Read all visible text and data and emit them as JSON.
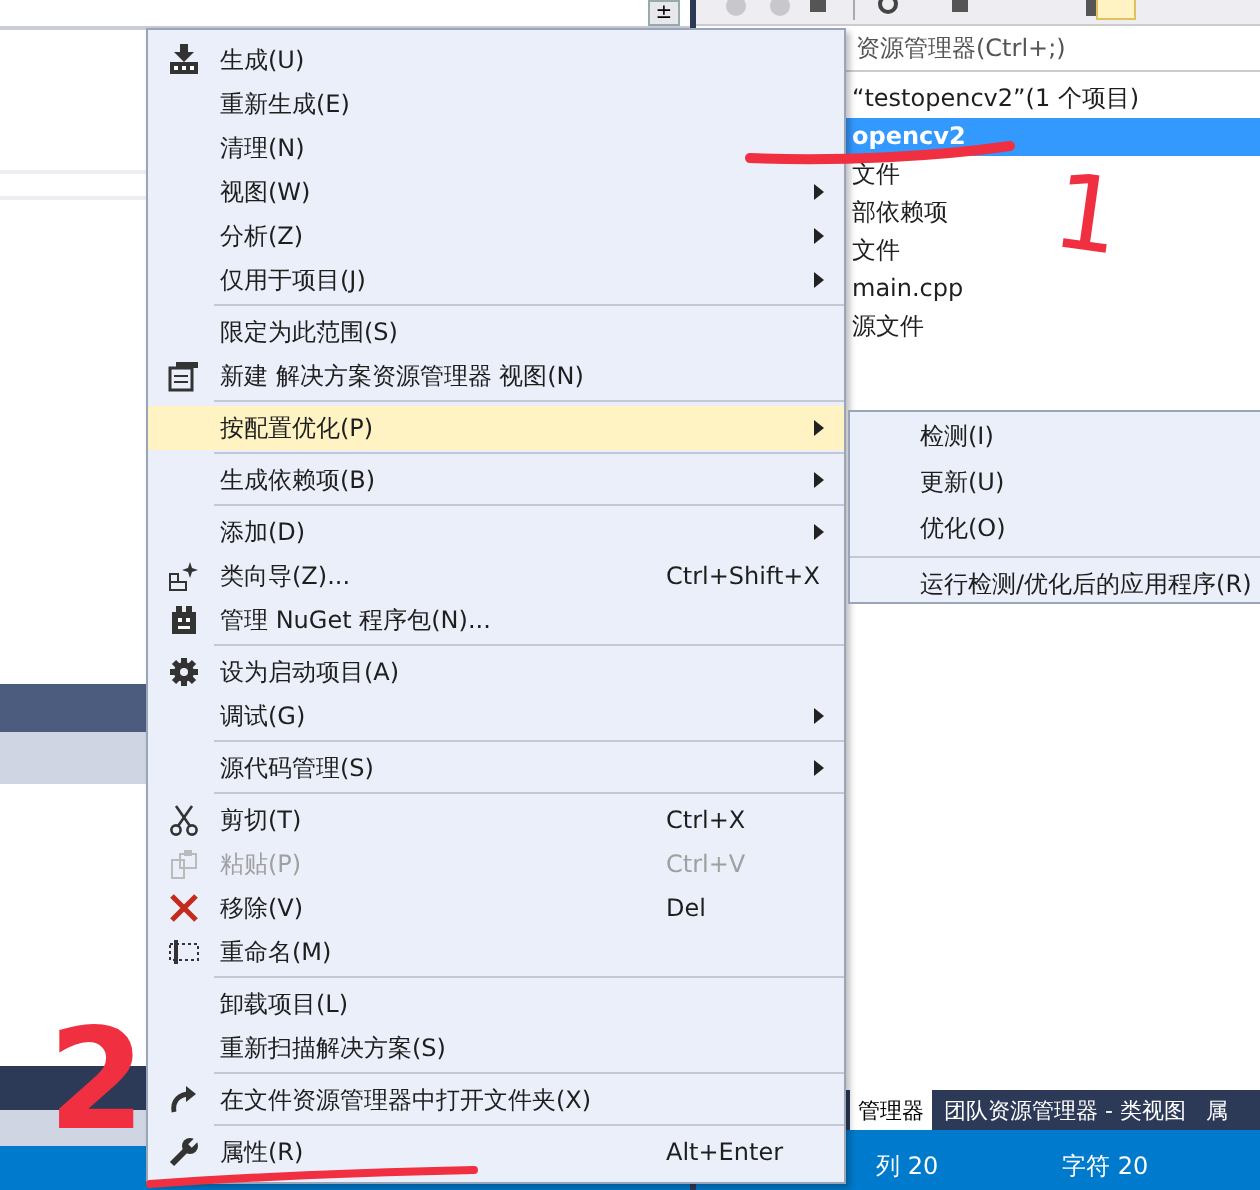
{
  "editor": {
    "pin_button": "±"
  },
  "solution_explorer": {
    "search": {
      "placeholder": "资源管理器(Ctrl+;)"
    },
    "tree": [
      {
        "label": "“testopencv2”(1 个项目)",
        "selected": false
      },
      {
        "label": "opencv2",
        "selected": true
      },
      {
        "label": "文件",
        "selected": false
      },
      {
        "label": "部依赖项",
        "selected": false
      },
      {
        "label": "文件",
        "selected": false
      },
      {
        "label": "main.cpp",
        "selected": false
      },
      {
        "label": "源文件",
        "selected": false
      }
    ]
  },
  "bottom_tabs": [
    {
      "label": "管理器",
      "selected": true
    },
    {
      "label": "团队资源管理器 - 类视图",
      "selected": false
    },
    {
      "label": "属",
      "selected": false
    }
  ],
  "status_bar": {
    "line": "列 20",
    "char": "字符 20"
  },
  "context_menu": {
    "items": [
      {
        "kind": "item",
        "label": "生成(U)",
        "selected": false,
        "disabled": false,
        "submenu": false
      },
      {
        "kind": "item",
        "label": "重新生成(E)",
        "selected": false,
        "disabled": false,
        "submenu": false
      },
      {
        "kind": "item",
        "label": "清理(N)",
        "selected": false,
        "disabled": false,
        "submenu": false
      },
      {
        "kind": "item",
        "label": "视图(W)",
        "selected": false,
        "disabled": false,
        "submenu": true
      },
      {
        "kind": "item",
        "label": "分析(Z)",
        "selected": false,
        "disabled": false,
        "submenu": true
      },
      {
        "kind": "item",
        "label": "仅用于项目(J)",
        "selected": false,
        "disabled": false,
        "submenu": true
      },
      {
        "kind": "separator"
      },
      {
        "kind": "item",
        "label": "限定为此范围(S)",
        "selected": false,
        "disabled": false,
        "submenu": false
      },
      {
        "kind": "item",
        "label": "新建 解决方案资源管理器 视图(N)",
        "selected": false,
        "disabled": false,
        "submenu": false
      },
      {
        "kind": "separator"
      },
      {
        "kind": "item",
        "label": "按配置优化(P)",
        "selected": true,
        "disabled": false,
        "submenu": true
      },
      {
        "kind": "separator"
      },
      {
        "kind": "item",
        "label": "生成依赖项(B)",
        "selected": false,
        "disabled": false,
        "submenu": true
      },
      {
        "kind": "separator"
      },
      {
        "kind": "item",
        "label": "添加(D)",
        "selected": false,
        "disabled": false,
        "submenu": true
      },
      {
        "kind": "item",
        "label": "类向导(Z)...",
        "shortcut": "Ctrl+Shift+X",
        "selected": false,
        "disabled": false,
        "submenu": false
      },
      {
        "kind": "item",
        "label": "管理 NuGet 程序包(N)...",
        "selected": false,
        "disabled": false,
        "submenu": false
      },
      {
        "kind": "separator"
      },
      {
        "kind": "item",
        "label": "设为启动项目(A)",
        "selected": false,
        "disabled": false,
        "submenu": false
      },
      {
        "kind": "item",
        "label": "调试(G)",
        "selected": false,
        "disabled": false,
        "submenu": true
      },
      {
        "kind": "separator"
      },
      {
        "kind": "item",
        "label": "源代码管理(S)",
        "selected": false,
        "disabled": false,
        "submenu": true
      },
      {
        "kind": "separator"
      },
      {
        "kind": "item",
        "label": "剪切(T)",
        "shortcut": "Ctrl+X",
        "selected": false,
        "disabled": false,
        "submenu": false
      },
      {
        "kind": "item",
        "label": "粘贴(P)",
        "shortcut": "Ctrl+V",
        "selected": false,
        "disabled": true,
        "submenu": false
      },
      {
        "kind": "item",
        "label": "移除(V)",
        "shortcut": "Del",
        "selected": false,
        "disabled": false,
        "submenu": false
      },
      {
        "kind": "item",
        "label": "重命名(M)",
        "selected": false,
        "disabled": false,
        "submenu": false
      },
      {
        "kind": "separator"
      },
      {
        "kind": "item",
        "label": "卸载项目(L)",
        "selected": false,
        "disabled": false,
        "submenu": false
      },
      {
        "kind": "item",
        "label": "重新扫描解决方案(S)",
        "selected": false,
        "disabled": false,
        "submenu": false
      },
      {
        "kind": "separator"
      },
      {
        "kind": "item",
        "label": "在文件资源管理器中打开文件夹(X)",
        "selected": false,
        "disabled": false,
        "submenu": false
      },
      {
        "kind": "separator"
      },
      {
        "kind": "item",
        "label": "属性(R)",
        "shortcut": "Alt+Enter",
        "selected": false,
        "disabled": false,
        "submenu": false
      }
    ]
  },
  "submenu": {
    "items": [
      {
        "kind": "item",
        "label": "检测(I)"
      },
      {
        "kind": "item",
        "label": "更新(U)"
      },
      {
        "kind": "item",
        "label": "优化(O)"
      },
      {
        "kind": "separator"
      },
      {
        "kind": "item",
        "label": "运行检测/优化后的应用程序(R)"
      }
    ]
  },
  "annotations": [
    {
      "label": "1"
    },
    {
      "label": "2"
    }
  ]
}
